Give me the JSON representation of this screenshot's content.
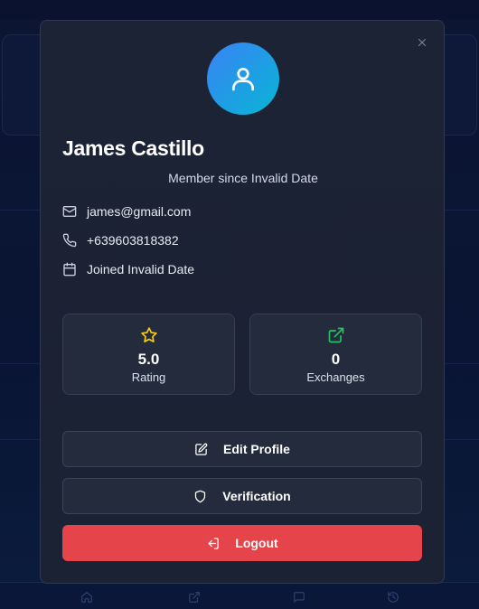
{
  "profile": {
    "name": "James Castillo",
    "member_since": "Member since Invalid Date",
    "email": "james@gmail.com",
    "phone": "+639603818382",
    "joined": "Joined Invalid Date"
  },
  "stats": [
    {
      "value": "5.0",
      "label": "Rating",
      "icon": "star-icon"
    },
    {
      "value": "0",
      "label": "Exchanges",
      "icon": "external-link-icon"
    }
  ],
  "actions": {
    "edit_profile": "Edit Profile",
    "verification": "Verification",
    "logout": "Logout"
  },
  "colors": {
    "avatar_gradient_start": "#3b82f6",
    "avatar_gradient_end": "#06b6d4",
    "star": "#facc15",
    "exchange": "#22c55e",
    "logout": "#e5444a"
  },
  "bottom_nav": [
    "home-icon",
    "exchange-icon",
    "chat-icon",
    "history-icon"
  ]
}
